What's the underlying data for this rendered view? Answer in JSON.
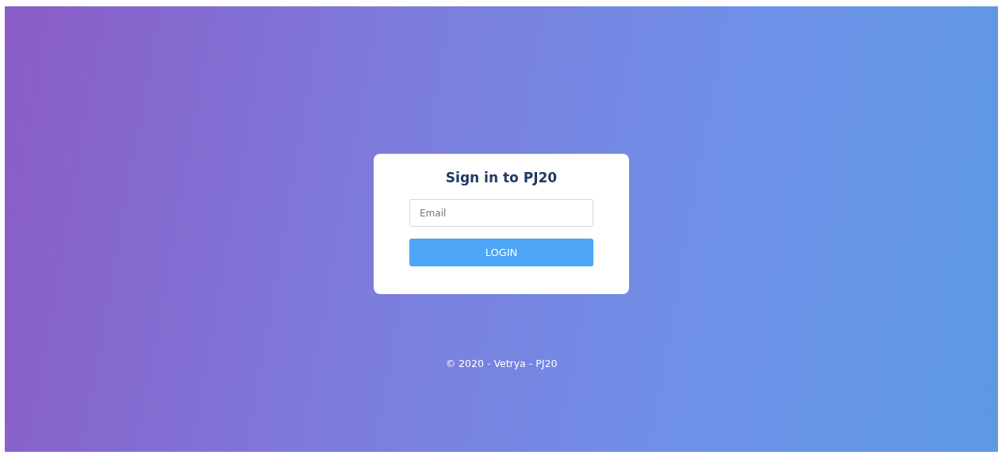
{
  "card": {
    "title": "Sign in to PJ20",
    "email": {
      "placeholder": "Email"
    },
    "button": "LOGIN"
  },
  "footer": "© 2020 - Vetrya - PJ20"
}
